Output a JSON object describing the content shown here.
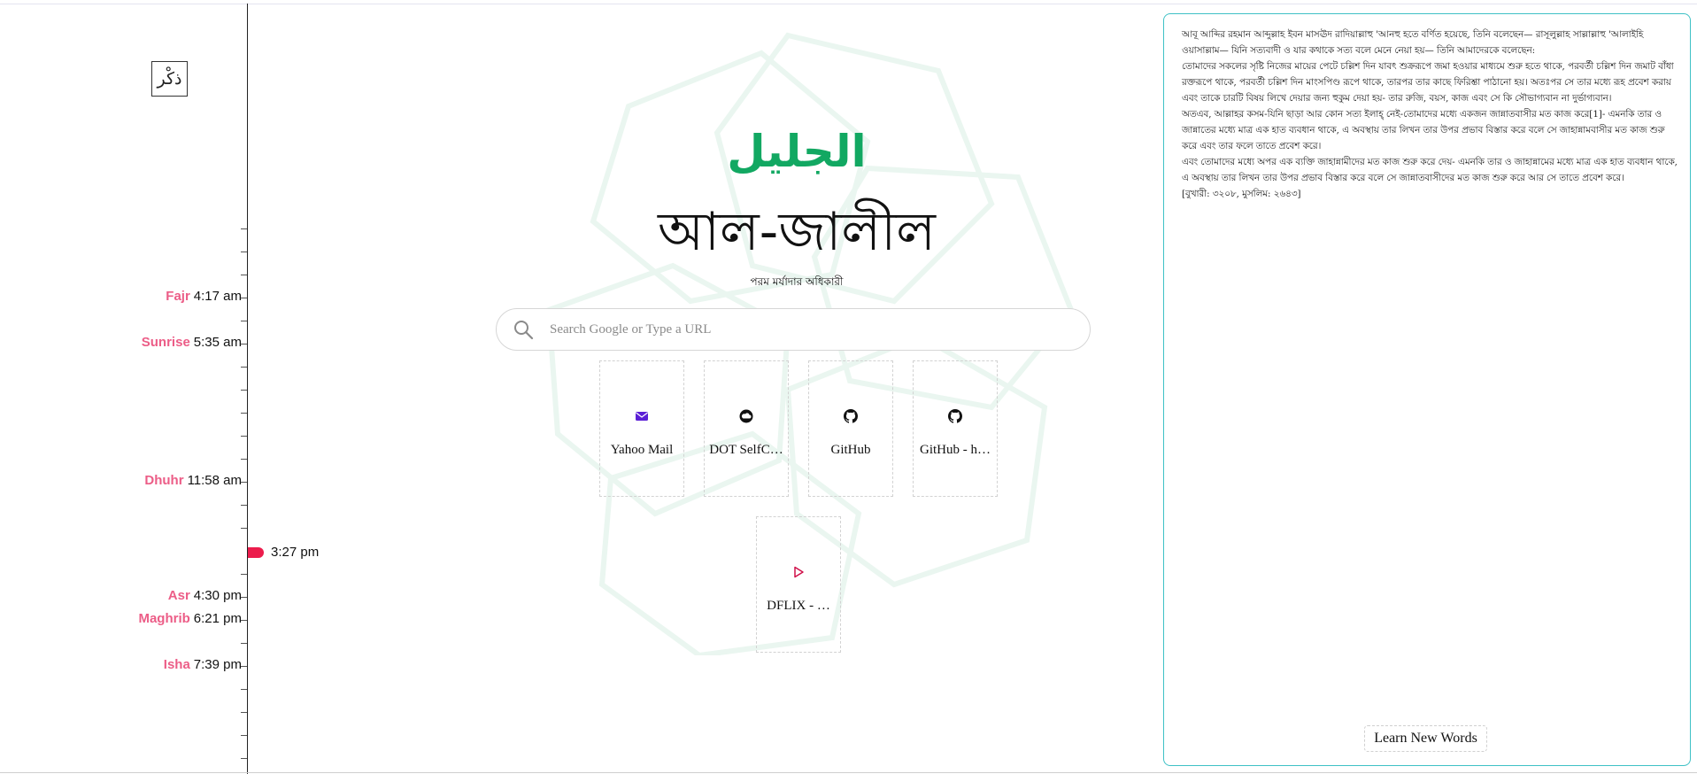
{
  "logo": {
    "text": "ذكْر"
  },
  "timeline": {
    "prayers": [
      {
        "name": "Fajr",
        "time": "4:17 am"
      },
      {
        "name": "Sunrise",
        "time": "5:35 am"
      },
      {
        "name": "Dhuhr",
        "time": "11:58 am"
      },
      {
        "name": "Asr",
        "time": "4:30 pm"
      },
      {
        "name": "Maghrib",
        "time": "6:21 pm"
      },
      {
        "name": "Isha",
        "time": "7:39 pm"
      }
    ],
    "current_time": "3:27 pm"
  },
  "name_card": {
    "arabic": "الجليل",
    "bengali": "আল-জালীল",
    "meaning": "পরম মর্যাদার অধিকারী"
  },
  "search": {
    "placeholder": "Search Google or Type a URL",
    "icon": "search-icon"
  },
  "shortcuts": [
    {
      "label": "Yahoo Mail",
      "icon": "mail-icon",
      "color": "#5b1fd6"
    },
    {
      "label": "DOT SelfC…",
      "icon": "cloud-icon",
      "color": "#111111"
    },
    {
      "label": "GitHub",
      "icon": "github-icon",
      "color": "#111111"
    },
    {
      "label": "GitHub - h…",
      "icon": "github-icon",
      "color": "#111111"
    },
    {
      "label": "DFLIX - …",
      "icon": "play-icon",
      "color": "#d0104a"
    }
  ],
  "hadith": {
    "paragraphs": [
      "আবূ আব্দির রহমান আব্দুল্লাহ ইবন মাসঊদ রাদিয়াল্লাহু 'আনহু হতে বর্ণিত হয়েছে, তিনি বলেছেন— রাসূলুল্লাহ সাল্লাল্লাহু 'আলাইহি ওয়াসাল্লাম— যিনি সত্যবাদী ও যার কথাকে সত্য বলে মেনে নেয়া হয়— তিনি আমাদেরকে বলেছেন:",
      "তোমাদের সকলের সৃষ্টি নিজের মায়ের পেটে চল্লিশ দিন যাবৎ শুক্ররূপে জমা হওয়ার মাধ্যমে শুরু হতে থাকে, পরবর্তী চল্লিশ দিন জমাট বাঁধা রক্তরূপে থাকে, পরবর্তী চল্লিশ দিন মাংসপিণ্ড রূপে থাকে, তারপর তার কাছে ফিরিশ্তা পাঠানো হয়। অতঃপর সে তার মধ্যে রূহ প্রবেশ করায় এবং তাকে চারটি বিষয় লিখে দেয়ার জন্য হুকুম দেয়া হয়- তার রুজি, বয়স, কাজ এবং সে কি সৌভাগ্যবান না দুর্ভাগ্যবান।",
      "অতএব, আল্লাহর কসম-যিনি ছাড়া আর কোন সত্য ইলাহ্ নেই-তোমাদের মধ্যে একজন জান্নাতবাসীর মত কাজ করে[1]- এমনকি তার ও জান্নাতের মধ্যে মাত্র এক হাত ব্যবধান থাকে, এ অবস্থায় তার লিখন তার উপর প্রভাব বিস্তার করে বলে সে জাহান্নামবাসীর মত কাজ শুরু করে এবং তার ফলে তাতে প্রবেশ করে।",
      "এবং তোমাদের মধ্যে অপর এক ব্যক্তি জাহান্নামীদের মত কাজ শুরু করে দেয়- এমনকি তার ও জাহান্নামের মধ্যে মাত্র এক হাত ব্যবধান থাকে, এ অবস্থায় তার লিখন তার উপর প্রভাব বিস্তার করে বলে সে জান্নাতবাসীদের মত কাজ শুরু করে আর সে তাতে প্রবেশ করে।",
      "[বুখারী: ৩২০৮, মুসলিম: ২৬৪৩]"
    ]
  },
  "learn_button": {
    "label": "Learn New Words"
  },
  "colors": {
    "accent_green": "#12a862",
    "prayer_pink": "#ec5d87",
    "now_red": "#ec1c4c",
    "panel_border": "#3fc1c6"
  }
}
